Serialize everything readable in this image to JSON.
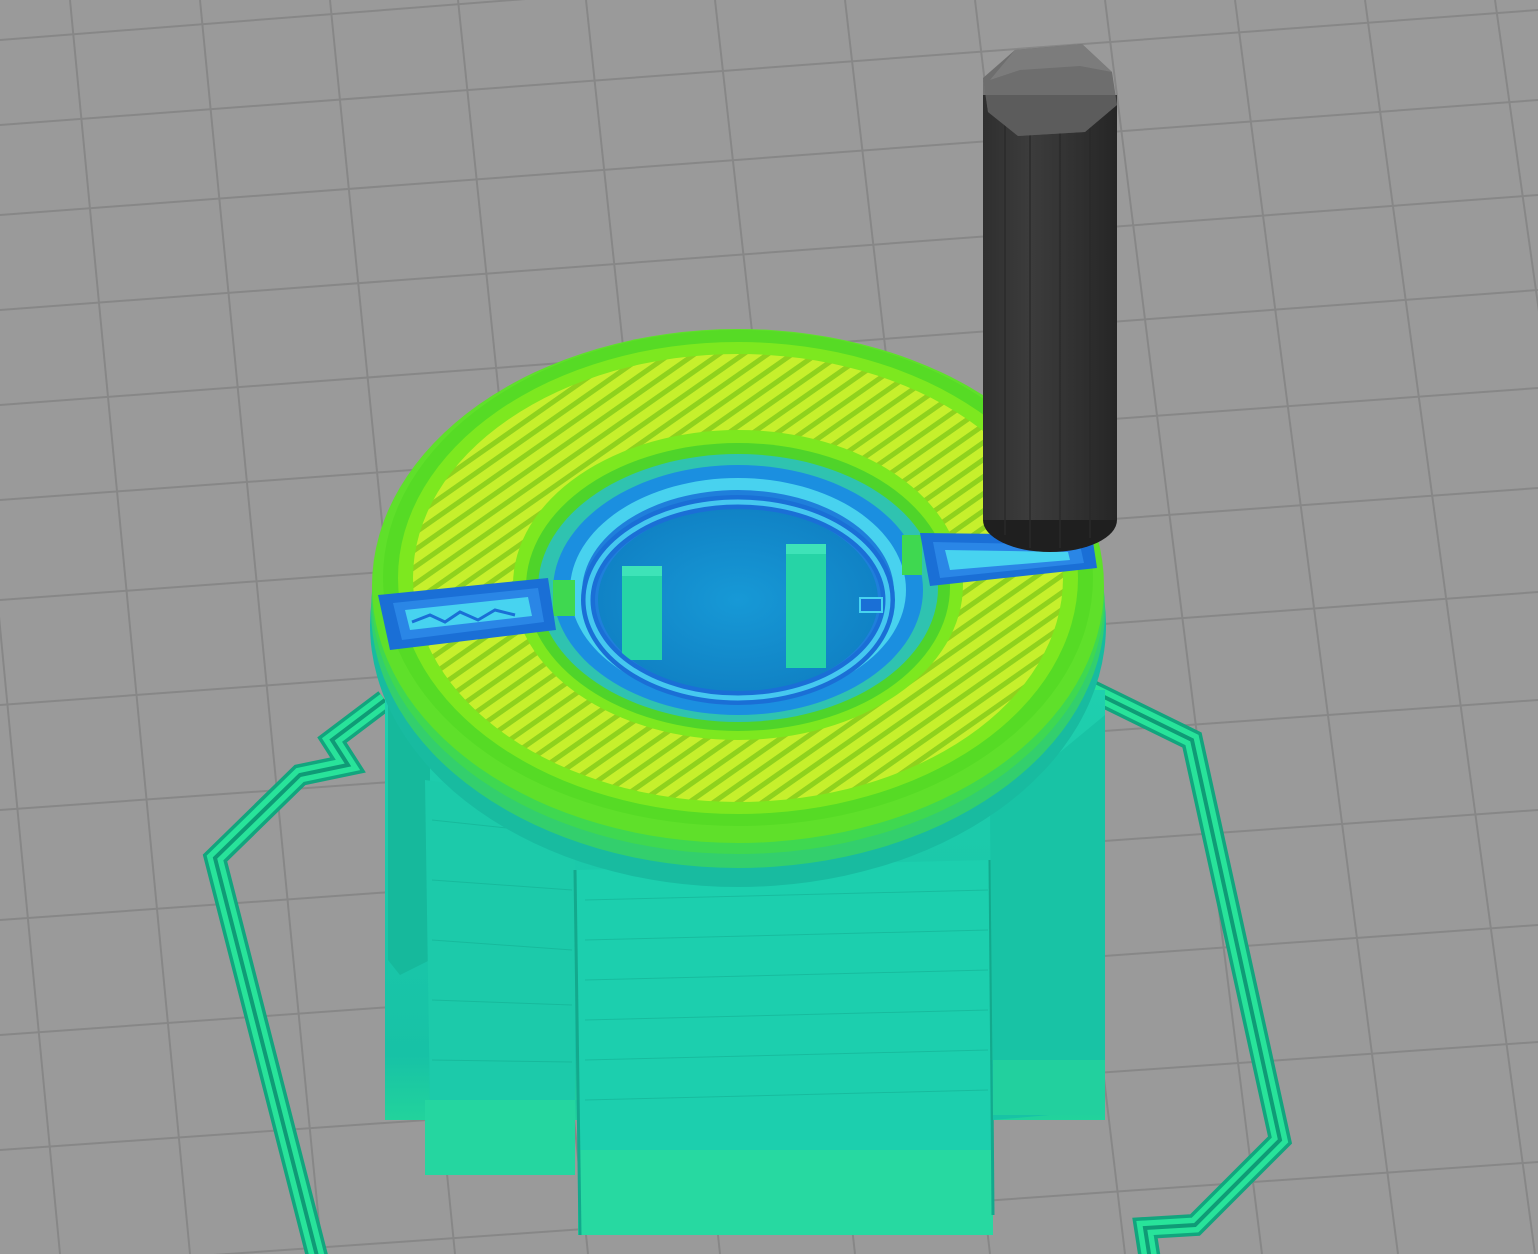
{
  "viewport": {
    "kind": "3d-gcode-preview",
    "colors": {
      "bed": "#9a9a9a",
      "bed_grid": "#8a8a8a",
      "skirt": "#28e39a",
      "walls": "#19c7a9",
      "walls_shade": "#12a88f",
      "ring_top_outer": "#5fe02a",
      "ring_infill": "#c6f02c",
      "ring_inner": "#1fb7e8",
      "bridge": "#1e70dc",
      "bridge_core": "#47d3f0",
      "nozzle": "#3a3a3a",
      "nozzle_top": "#6a6a6a"
    },
    "icons": [
      "nozzle-tool-icon"
    ]
  }
}
